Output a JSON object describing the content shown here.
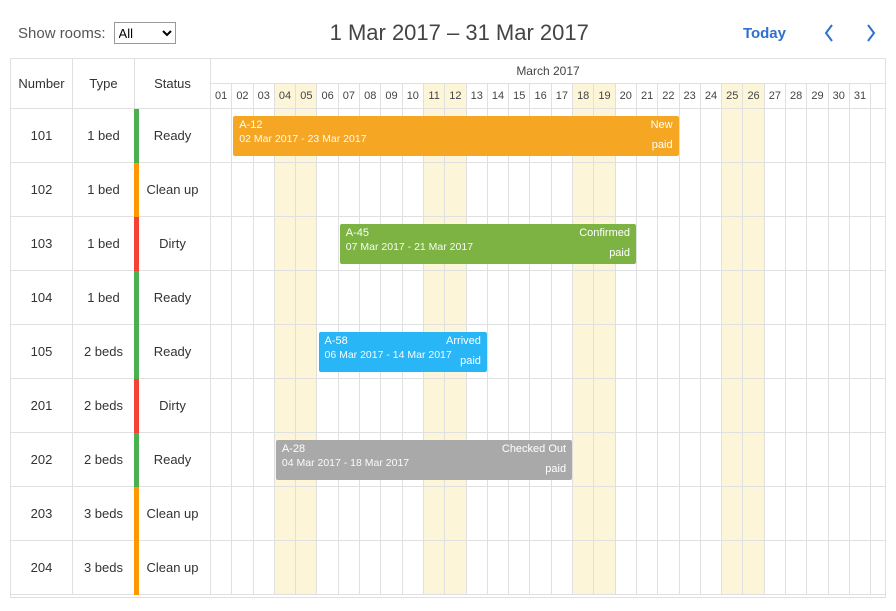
{
  "filter": {
    "label": "Show rooms:",
    "selected": "All"
  },
  "date_range": "1 Mar 2017 – 31 Mar 2017",
  "today_label": "Today",
  "month_header": "March 2017",
  "columns": {
    "number": "Number",
    "type": "Type",
    "status": "Status"
  },
  "rooms": [
    {
      "number": "101",
      "type": "1 bed",
      "status": "Ready",
      "stripe": "green"
    },
    {
      "number": "102",
      "type": "1 bed",
      "status": "Clean up",
      "stripe": "orange"
    },
    {
      "number": "103",
      "type": "1 bed",
      "status": "Dirty",
      "stripe": "red"
    },
    {
      "number": "104",
      "type": "1 bed",
      "status": "Ready",
      "stripe": "green"
    },
    {
      "number": "105",
      "type": "2 beds",
      "status": "Ready",
      "stripe": "green"
    },
    {
      "number": "201",
      "type": "2 beds",
      "status": "Dirty",
      "stripe": "red"
    },
    {
      "number": "202",
      "type": "2 beds",
      "status": "Ready",
      "stripe": "green"
    },
    {
      "number": "203",
      "type": "3 beds",
      "status": "Clean up",
      "stripe": "orange"
    },
    {
      "number": "204",
      "type": "3 beds",
      "status": "Clean up",
      "stripe": "orange"
    }
  ],
  "weekend_days": [
    4,
    5,
    11,
    12,
    18,
    19,
    25,
    26
  ],
  "bookings": [
    {
      "row": 0,
      "title": "A-12",
      "dates": "02 Mar 2017 - 23 Mar 2017",
      "status": "New",
      "pay": "paid",
      "color": "orange",
      "start": 2,
      "end": 23
    },
    {
      "row": 2,
      "title": "A-45",
      "dates": "07 Mar 2017 - 21 Mar 2017",
      "status": "Confirmed",
      "pay": "paid",
      "color": "green",
      "start": 7,
      "end": 21
    },
    {
      "row": 4,
      "title": "A-58",
      "dates": "06 Mar 2017 - 14 Mar 2017",
      "status": "Arrived",
      "pay": "paid",
      "color": "blue",
      "start": 6,
      "end": 14
    },
    {
      "row": 6,
      "title": "A-28",
      "dates": "04 Mar 2017 - 18 Mar 2017",
      "status": "Checked Out",
      "pay": "paid",
      "color": "gray",
      "start": 4,
      "end": 18
    }
  ]
}
